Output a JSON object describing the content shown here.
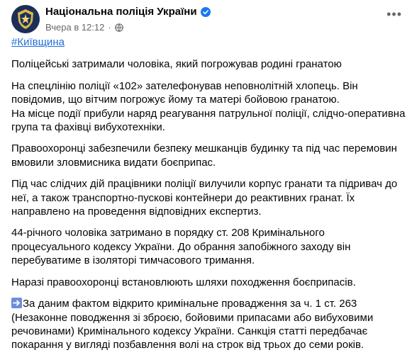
{
  "page": {
    "name": "Національна поліція України",
    "timestamp": "Вчера в 12:12",
    "separator": "·"
  },
  "icons": {
    "avatar": "police-emblem-icon",
    "verified": "verified-badge-icon",
    "audience": "globe-icon",
    "more": "more-options-icon",
    "arrow": "right-arrow-emoji-icon"
  },
  "colors": {
    "link": "#216fdb",
    "meta": "#65676b",
    "verified": "#1877f2",
    "avatar_bg": "#1b2f58"
  },
  "post": {
    "hashtag": "#Київщина",
    "paragraphs": [
      {
        "lines": [
          "Поліцейські затримали чоловіка, який погрожував родині гранатою"
        ]
      },
      {
        "lines": [
          "На спецлінію поліції «102» зателефонував неповнолітній хлопець. Він",
          "повідомив, що вітчим погрожує йому та матері бойовою гранатою.",
          "На місце події прибули наряд реагування патрульної поліції, слідчо-оперативна",
          "група та фахівці вибухотехніки."
        ]
      },
      {
        "lines": [
          "Правоохоронці забезпечили безпеку мешканців будинку та під час перемовин",
          "вмовили зловмисника видати боєприпас."
        ]
      },
      {
        "lines": [
          "Під час слідчих дій працівники поліції вилучили корпус гранати та підривач до",
          "неї, а також транспортно-пускові контейнери до реактивних гранат. Їх",
          "направлено на проведення відповідних експертиз."
        ]
      },
      {
        "lines": [
          "44-річного чоловіка затримано в порядку ст. 208 Кримінального",
          "процесуального кодексу України. До обрання запобіжного заходу він",
          "перебуватиме в ізоляторі тимчасового тримання."
        ]
      },
      {
        "lines": [
          "Наразі правоохоронці встановлюють шляхи походження боєприпасів."
        ]
      },
      {
        "lines": [
          "За даним фактом відкрито кримінальне провадження за ч. 1 ст. 263",
          "(Незаконне поводження зі зброєю, бойовими припасами або вибуховими",
          "речовинами)  Кримінального кодексу України. Санкція статті передбачає",
          "покарання у вигляді позбавлення волі на строк від трьох до семи років."
        ]
      }
    ]
  }
}
